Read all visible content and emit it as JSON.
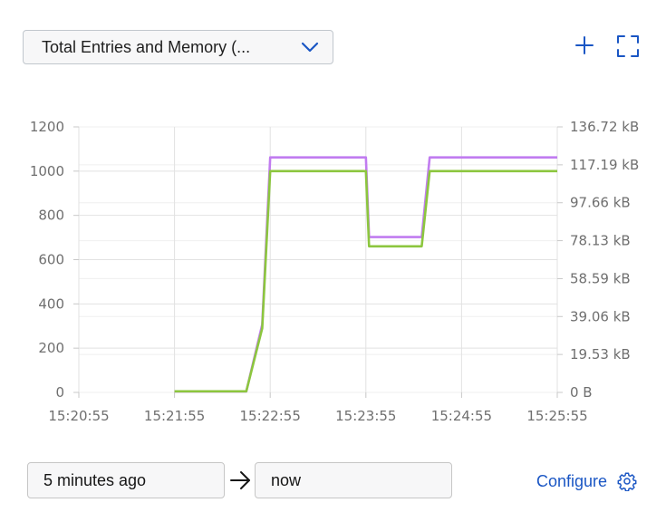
{
  "header": {
    "dropdown_label": "Total Entries and Memory (..."
  },
  "icons": {
    "add": "plus-icon",
    "expand": "fullscreen-icon",
    "chevron": "chevron-down-icon",
    "arrow": "arrow-right-icon",
    "gear": "gear-icon"
  },
  "chart_data": {
    "type": "line",
    "title": "",
    "x_ticks": [
      "15:20:55",
      "15:21:55",
      "15:22:55",
      "15:23:55",
      "15:24:55",
      "15:25:55"
    ],
    "y_left_ticks": [
      "0",
      "200",
      "400",
      "600",
      "800",
      "1000",
      "1200"
    ],
    "y_left_range": [
      0,
      1200
    ],
    "y_right_ticks": [
      "0 B",
      "19.53 kB",
      "39.06 kB",
      "58.59 kB",
      "78.13 kB",
      "97.66 kB",
      "117.19 kB",
      "136.72 kB"
    ],
    "y_right_range_kB": [
      0,
      136.72
    ],
    "grid": true,
    "series": [
      {
        "axis": "right",
        "unit": "kB",
        "color": "#c17cf0",
        "x": [
          "15:21:55",
          "15:22:40",
          "15:22:50",
          "15:22:55",
          "15:23:55",
          "15:23:57",
          "15:24:30",
          "15:24:35",
          "15:25:55"
        ],
        "values": [
          0.5,
          0.5,
          35,
          121,
          121,
          80,
          80,
          121,
          121
        ]
      },
      {
        "axis": "left",
        "color": "#8cc63e",
        "x": [
          "15:21:55",
          "15:22:40",
          "15:22:50",
          "15:22:55",
          "15:23:55",
          "15:23:57",
          "15:24:30",
          "15:24:35",
          "15:25:55"
        ],
        "values": [
          5,
          5,
          290,
          1000,
          1000,
          660,
          660,
          1000,
          1000
        ]
      }
    ]
  },
  "time_range": {
    "from": "5 minutes ago",
    "to": "now"
  },
  "configure": {
    "label": "Configure"
  },
  "colors": {
    "accent": "#1a56c4",
    "series_memory": "#c17cf0",
    "series_entries": "#8cc63e"
  }
}
